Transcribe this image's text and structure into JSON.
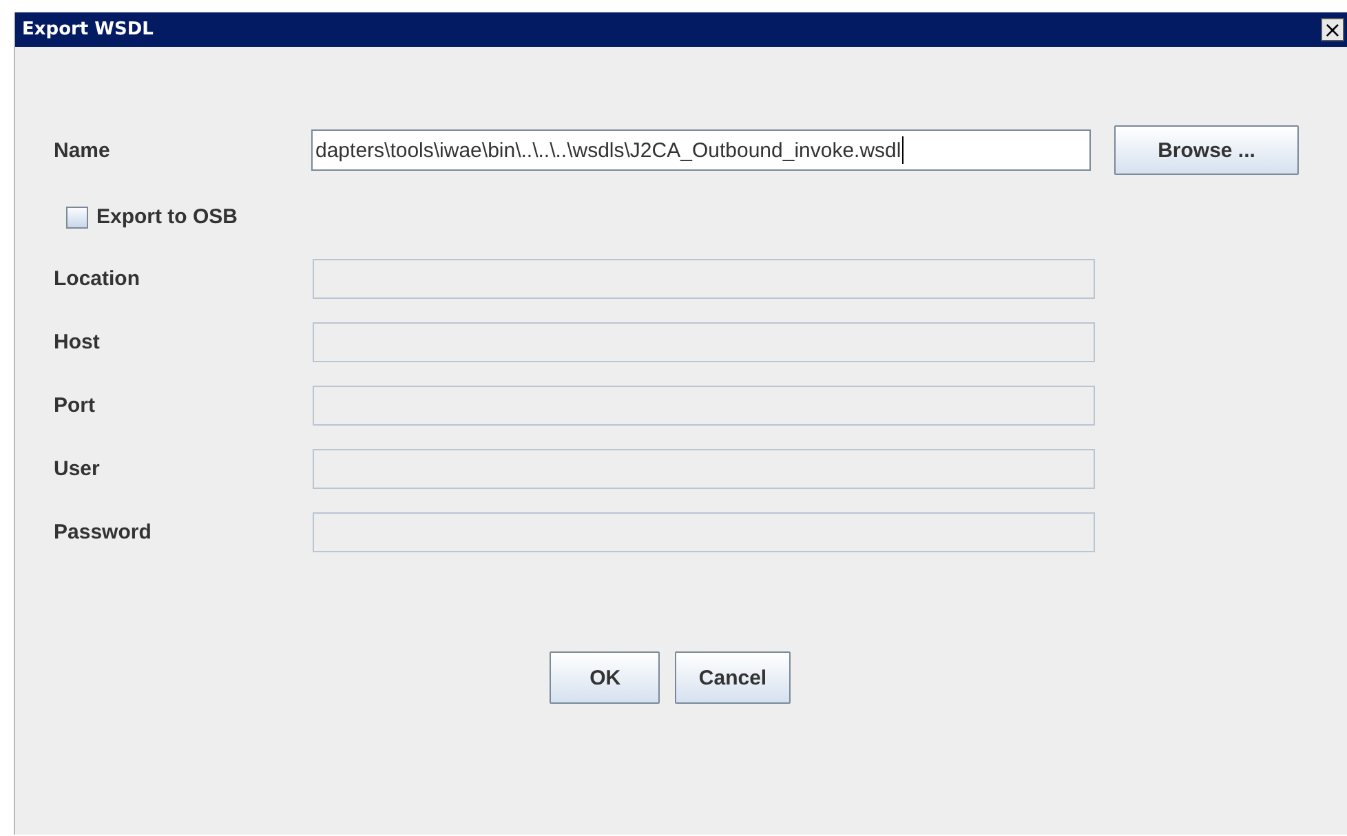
{
  "window": {
    "title": "Export WSDL",
    "close": "×"
  },
  "name": {
    "label": "Name",
    "value": "dapters\\tools\\iwae\\bin\\..\\..\\..\\wsdls\\J2CA_Outbound_invoke.wsdl",
    "button": "Browse ..."
  },
  "export_to_osb": {
    "label": "Export to OSB",
    "checked": false
  },
  "fields": [
    {
      "label": "Location",
      "disabled": true
    },
    {
      "label": "Host",
      "disabled": true
    },
    {
      "label": "Port",
      "disabled": true
    },
    {
      "label": "User",
      "disabled": true
    },
    {
      "label": "Password",
      "disabled": true
    }
  ],
  "buttons": [
    "OK",
    "Cancel"
  ]
}
